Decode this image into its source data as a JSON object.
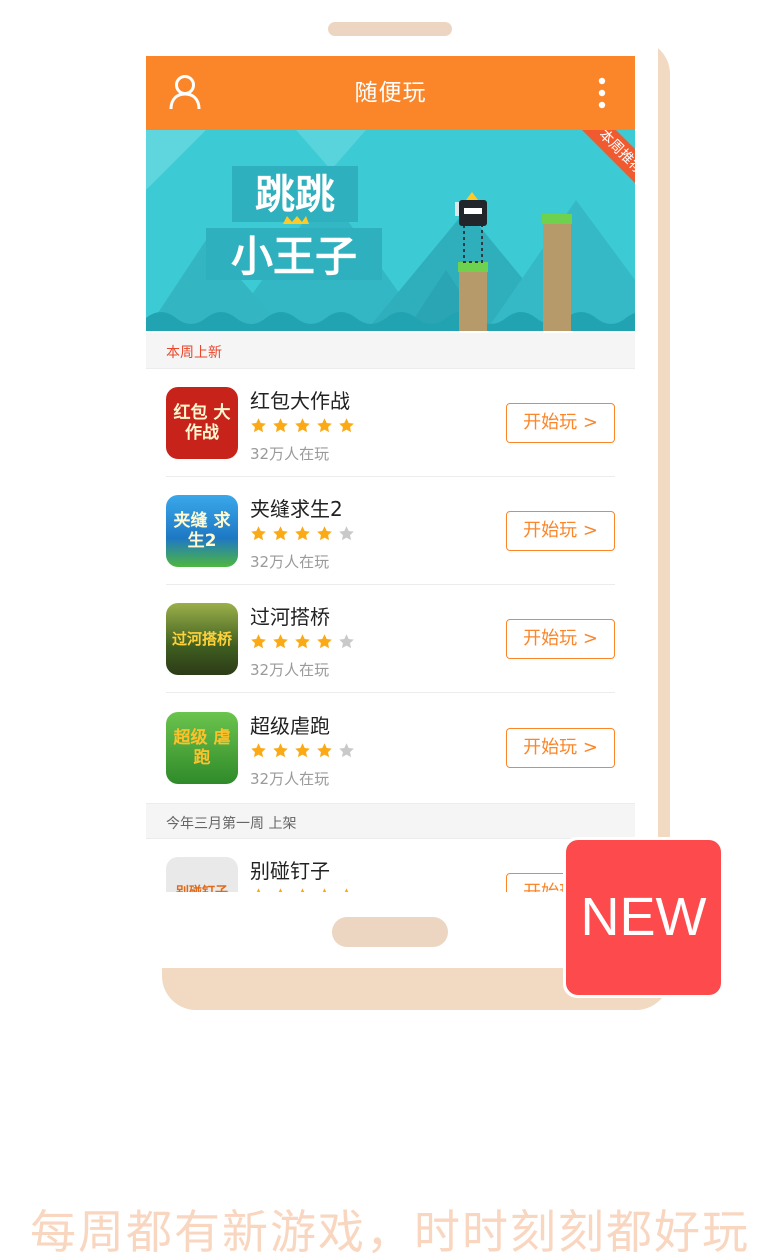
{
  "app_bar": {
    "title": "随便玩",
    "user_icon": "user-icon",
    "menu_icon": "more-vert-icon",
    "color": "#fb8529"
  },
  "banner": {
    "game_title_line1": "跳跳",
    "game_title_line2": "小王子",
    "ribbon": "本周推荐"
  },
  "sections": [
    {
      "label": "本周上新"
    },
    {
      "label": "今年三月第一周 上架"
    }
  ],
  "games": [
    {
      "name": "红包大作战",
      "rating": 5,
      "players": "32万人在玩",
      "button": "开始玩 >",
      "icon_text": "红包 大作战",
      "icon_color": "#c8231a"
    },
    {
      "name": "夹缝求生2",
      "rating": 4,
      "players": "32万人在玩",
      "button": "开始玩 >",
      "icon_text": "夹缝 求生2",
      "icon_color": "#1e8fd6"
    },
    {
      "name": "过河搭桥",
      "rating": 4,
      "players": "32万人在玩",
      "button": "开始玩 >",
      "icon_text": "过河搭桥",
      "icon_color": "#6b7a2a"
    },
    {
      "name": "超级虐跑",
      "rating": 4,
      "players": "32万人在玩",
      "button": "开始玩 >",
      "icon_text": "超级 虐跑",
      "icon_color": "#3d9b2f"
    },
    {
      "name": "别碰钉子",
      "rating": 5,
      "players": "",
      "button": "开始玩 >",
      "icon_text": "别碰钉子",
      "icon_color": "#e9e9e9"
    }
  ],
  "badge": {
    "text": "NEW",
    "color": "#fd4a4c"
  },
  "tagline": "每周都有新游戏，时时刻刻都好玩",
  "colors": {
    "star_on": "#fbaa15",
    "star_off": "#c9c9c9",
    "accent": "#fb8529"
  }
}
